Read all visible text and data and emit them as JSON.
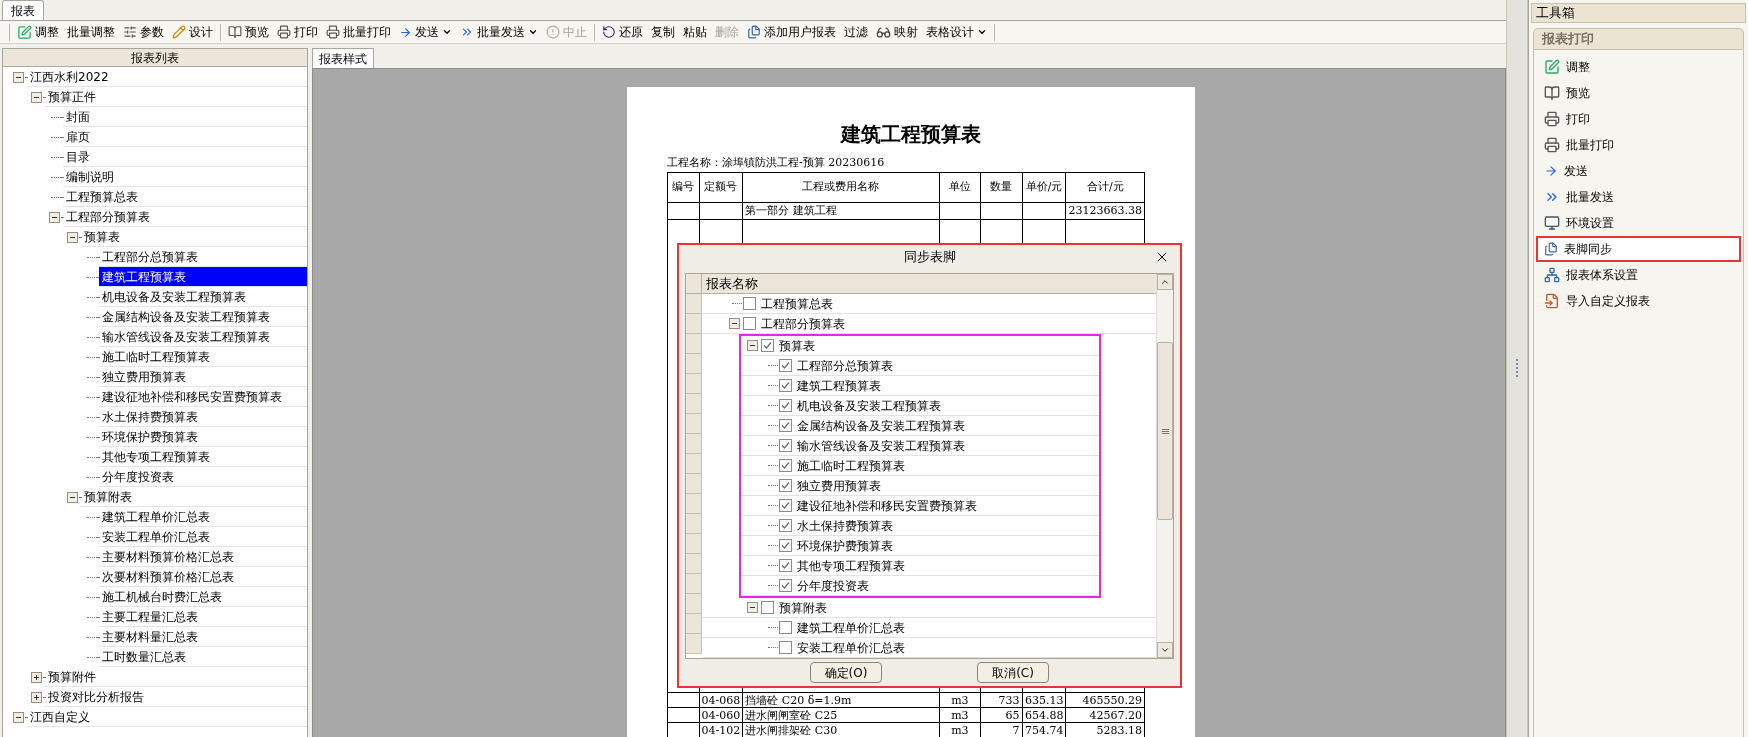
{
  "top_tab": {
    "label": "报表",
    "selected": true
  },
  "toolbar": [
    {
      "kind": "separator"
    },
    {
      "kind": "button",
      "label": "调整",
      "dropdown": false,
      "disabled": false
    },
    {
      "kind": "button",
      "label": "批量调整",
      "dropdown": false,
      "disabled": false
    },
    {
      "kind": "button",
      "label": "参数",
      "dropdown": false,
      "disabled": false
    },
    {
      "kind": "button",
      "label": "设计",
      "dropdown": false,
      "disabled": false
    },
    {
      "kind": "separator"
    },
    {
      "kind": "button",
      "label": "预览",
      "dropdown": false,
      "disabled": false
    },
    {
      "kind": "button",
      "label": "打印",
      "dropdown": false,
      "disabled": false
    },
    {
      "kind": "button",
      "label": "批量打印",
      "dropdown": false,
      "disabled": false
    },
    {
      "kind": "button",
      "label": "发送",
      "dropdown": true,
      "disabled": false
    },
    {
      "kind": "button",
      "label": "批量发送",
      "dropdown": true,
      "disabled": false
    },
    {
      "kind": "button",
      "label": "中止",
      "dropdown": false,
      "disabled": true
    },
    {
      "kind": "separator"
    },
    {
      "kind": "button",
      "label": "还原",
      "dropdown": false,
      "disabled": false
    },
    {
      "kind": "button",
      "label": "复制",
      "dropdown": false,
      "disabled": false
    },
    {
      "kind": "button",
      "label": "粘贴",
      "dropdown": false,
      "disabled": false
    },
    {
      "kind": "button",
      "label": "删除",
      "dropdown": false,
      "disabled": true
    },
    {
      "kind": "button",
      "label": "添加用户报表",
      "dropdown": false,
      "disabled": false
    },
    {
      "kind": "button",
      "label": "过滤",
      "dropdown": false,
      "disabled": false
    },
    {
      "kind": "button",
      "label": "映射",
      "dropdown": false,
      "disabled": false
    },
    {
      "kind": "button",
      "label": "表格设计",
      "dropdown": true,
      "disabled": false
    },
    {
      "kind": "separator"
    }
  ],
  "report_list": {
    "title": "报表列表",
    "tree": [
      {
        "label": "江西水利2022",
        "selected": false,
        "expanded": true,
        "children": [
          {
            "label": "预算正件",
            "selected": false,
            "expanded": true,
            "children": [
              {
                "label": "封面",
                "selected": false
              },
              {
                "label": "扉页",
                "selected": false
              },
              {
                "label": "目录",
                "selected": false
              },
              {
                "label": "编制说明",
                "selected": false
              },
              {
                "label": "工程预算总表",
                "selected": false
              },
              {
                "label": "工程部分预算表",
                "selected": false,
                "expanded": true,
                "children": [
                  {
                    "label": "预算表",
                    "selected": false,
                    "expanded": true,
                    "children": [
                      {
                        "label": "工程部分总预算表",
                        "selected": false
                      },
                      {
                        "label": "建筑工程预算表",
                        "selected": true
                      },
                      {
                        "label": "机电设备及安装工程预算表",
                        "selected": false
                      },
                      {
                        "label": "金属结构设备及安装工程预算表",
                        "selected": false
                      },
                      {
                        "label": "输水管线设备及安装工程预算表",
                        "selected": false
                      },
                      {
                        "label": "施工临时工程预算表",
                        "selected": false
                      },
                      {
                        "label": "独立费用预算表",
                        "selected": false
                      },
                      {
                        "label": "建设征地补偿和移民安置费预算表",
                        "selected": false
                      },
                      {
                        "label": "水土保持费预算表",
                        "selected": false
                      },
                      {
                        "label": "环境保护费预算表",
                        "selected": false
                      },
                      {
                        "label": "其他专项工程预算表",
                        "selected": false
                      },
                      {
                        "label": "分年度投资表",
                        "selected": false
                      }
                    ]
                  },
                  {
                    "label": "预算附表",
                    "selected": false,
                    "expanded": true,
                    "children": [
                      {
                        "label": "建筑工程单价汇总表",
                        "selected": false
                      },
                      {
                        "label": "安装工程单价汇总表",
                        "selected": false
                      },
                      {
                        "label": "主要材料预算价格汇总表",
                        "selected": false
                      },
                      {
                        "label": "次要材料预算价格汇总表",
                        "selected": false
                      },
                      {
                        "label": "施工机械台时费汇总表",
                        "selected": false
                      },
                      {
                        "label": "主要工程量汇总表",
                        "selected": false
                      },
                      {
                        "label": "主要材料量汇总表",
                        "selected": false
                      },
                      {
                        "label": "工时数量汇总表",
                        "selected": false
                      }
                    ]
                  }
                ]
              }
            ]
          },
          {
            "label": "预算附件",
            "selected": false,
            "expanded": false
          },
          {
            "label": "投资对比分析报告",
            "selected": false,
            "expanded": false
          }
        ]
      },
      {
        "label": "江西自定义",
        "selected": false,
        "expanded": true
      }
    ]
  },
  "preview": {
    "tab": {
      "label": "报表样式",
      "selected": true
    },
    "document": {
      "title": "建筑工程预算表",
      "project": "工程名称：涂埠镇防洪工程-预算 20230616",
      "columns": [
        "编号",
        "定额号",
        "工程或费用名称",
        "单位",
        "数量",
        "单价/元",
        "合计/元"
      ],
      "rows_top": [
        {
          "name": "第一部分 建筑工程",
          "total": "23123663.38"
        }
      ],
      "rows_bottom": [
        {
          "code": "04-068",
          "name": "挡墙砼 C20 δ=1.9m",
          "unit": "m3",
          "quantity": "733",
          "price": "635.13",
          "total": "465550.29"
        },
        {
          "code": "04-060",
          "name": "进水闸闸室砼 C25",
          "unit": "m3",
          "quantity": "65",
          "price": "654.88",
          "total": "42567.20"
        },
        {
          "code": "04-102",
          "name": "进水闸排架砼 C30",
          "unit": "m3",
          "quantity": "7",
          "price": "754.74",
          "total": "5283.18"
        }
      ]
    }
  },
  "dialog": {
    "title": "同步表脚",
    "highlighted": true,
    "column": "报表名称",
    "tree": [
      {
        "label": "工程预算总表",
        "checked": false
      },
      {
        "label": "工程部分预算表",
        "checked": false,
        "expanded": true,
        "children": [
          {
            "label": "预算表",
            "checked": true,
            "expanded": true,
            "highlighted": true,
            "children": [
              {
                "label": "工程部分总预算表",
                "checked": true
              },
              {
                "label": "建筑工程预算表",
                "checked": true
              },
              {
                "label": "机电设备及安装工程预算表",
                "checked": true
              },
              {
                "label": "金属结构设备及安装工程预算表",
                "checked": true
              },
              {
                "label": "输水管线设备及安装工程预算表",
                "checked": true
              },
              {
                "label": "施工临时工程预算表",
                "checked": true
              },
              {
                "label": "独立费用预算表",
                "checked": true
              },
              {
                "label": "建设征地补偿和移民安置费预算表",
                "checked": true
              },
              {
                "label": "水土保持费预算表",
                "checked": true
              },
              {
                "label": "环境保护费预算表",
                "checked": true
              },
              {
                "label": "其他专项工程预算表",
                "checked": true
              },
              {
                "label": "分年度投资表",
                "checked": true
              }
            ]
          },
          {
            "label": "预算附表",
            "checked": false,
            "expanded": true,
            "children": [
              {
                "label": "建筑工程单价汇总表",
                "checked": false
              },
              {
                "label": "安装工程单价汇总表",
                "checked": false
              }
            ]
          }
        ]
      }
    ],
    "buttons": [
      "确定(O)",
      "取消(C)"
    ]
  },
  "toolbox": {
    "title": "工具箱",
    "group": "报表打印",
    "items": [
      {
        "label": "调整",
        "highlighted": false
      },
      {
        "label": "预览",
        "highlighted": false
      },
      {
        "label": "打印",
        "highlighted": false
      },
      {
        "label": "批量打印",
        "highlighted": false
      },
      {
        "label": "发送",
        "highlighted": false
      },
      {
        "label": "批量发送",
        "highlighted": false
      },
      {
        "label": "环境设置",
        "highlighted": false
      },
      {
        "label": "表脚同步",
        "highlighted": true
      },
      {
        "label": "报表体系设置",
        "highlighted": false
      },
      {
        "label": "导入自定义报表",
        "highlighted": false
      }
    ]
  }
}
